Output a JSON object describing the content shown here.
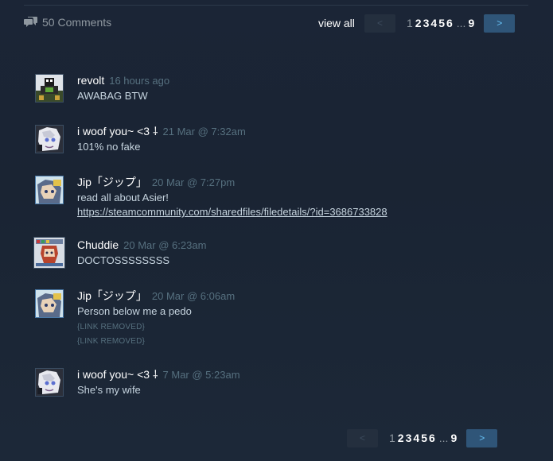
{
  "header": {
    "comments_count": "50 Comments",
    "view_all": "view all"
  },
  "pagination": {
    "prev": "<",
    "next": ">",
    "current": "1",
    "pages": [
      "2",
      "3",
      "4",
      "5",
      "6"
    ],
    "ellipsis": "...",
    "last": "9"
  },
  "comments": [
    {
      "author": "revolt",
      "time": "16 hours ago",
      "lines": [
        "AWABAG BTW"
      ],
      "avatar": "pixel-robot"
    },
    {
      "author": "i woof you~ <3 ⸸",
      "time": "21 Mar @ 7:32am",
      "lines": [
        "101% no fake"
      ],
      "avatar": "anime-girl"
    },
    {
      "author": "Jip「ジップ」",
      "time": "20 Mar @ 7:27pm",
      "lines": [
        "read all about Asier!"
      ],
      "link": "https://steamcommunity.com/sharedfiles/filedetails/?id=3686733828",
      "avatar": "blue-anime"
    },
    {
      "author": "Chuddie",
      "time": "20 Mar @ 6:23am",
      "lines": [
        "DOCTOSSSSSSSS"
      ],
      "avatar": "pixel-girl"
    },
    {
      "author": "Jip「ジップ」",
      "time": "20 Mar @ 6:06am",
      "lines": [
        "Person below me a pedo"
      ],
      "removed": [
        "{LINK REMOVED}",
        "{LINK REMOVED}"
      ],
      "avatar": "blue-anime"
    },
    {
      "author": "i woof you~ <3 ⸸",
      "time": "7 Mar @ 5:23am",
      "lines": [
        "She's my wife"
      ],
      "avatar": "anime-girl"
    }
  ]
}
